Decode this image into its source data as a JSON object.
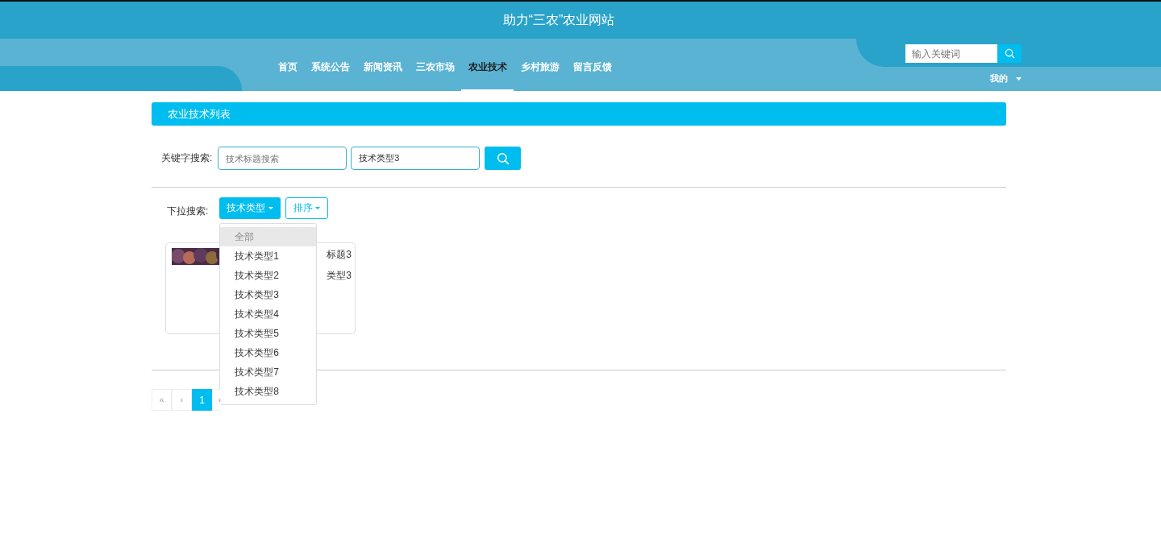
{
  "header": {
    "title": "助力“三农”农业网站",
    "search": {
      "placeholder": "输入关键词"
    },
    "user_menu": "我的"
  },
  "nav": [
    {
      "label": "首页",
      "selected": false
    },
    {
      "label": "系统公告",
      "selected": false
    },
    {
      "label": "新闻资讯",
      "selected": false
    },
    {
      "label": "三农市场",
      "selected": false
    },
    {
      "label": "农业技术",
      "selected": true
    },
    {
      "label": "乡村旅游",
      "selected": false
    },
    {
      "label": "留言反馈",
      "selected": false
    }
  ],
  "panel_title": "农业技术列表",
  "keyword_search": {
    "label": "关键字搜索:",
    "title_field": {
      "placeholder": "技术标题搜索"
    },
    "type_field": {
      "value": "技术类型3"
    }
  },
  "dropdown_search": {
    "label": "下拉搜索:",
    "type_button": "技术类型",
    "sort_button": "排序",
    "type_menu": [
      {
        "label": "全部",
        "hovered": true
      },
      {
        "label": "技术类型1",
        "hovered": false
      },
      {
        "label": "技术类型2",
        "hovered": false
      },
      {
        "label": "技术类型3",
        "hovered": false
      },
      {
        "label": "技术类型4",
        "hovered": false
      },
      {
        "label": "技术类型5",
        "hovered": false
      },
      {
        "label": "技术类型6",
        "hovered": false
      },
      {
        "label": "技术类型7",
        "hovered": false
      },
      {
        "label": "技术类型8",
        "hovered": false
      }
    ]
  },
  "cards": [
    {
      "title": "标题3",
      "type": "类型3"
    }
  ],
  "pagination": [
    {
      "label": "«",
      "selected": false
    },
    {
      "label": "‹",
      "selected": false
    },
    {
      "label": "1",
      "selected": true
    },
    {
      "label": "›",
      "selected": false
    }
  ]
}
